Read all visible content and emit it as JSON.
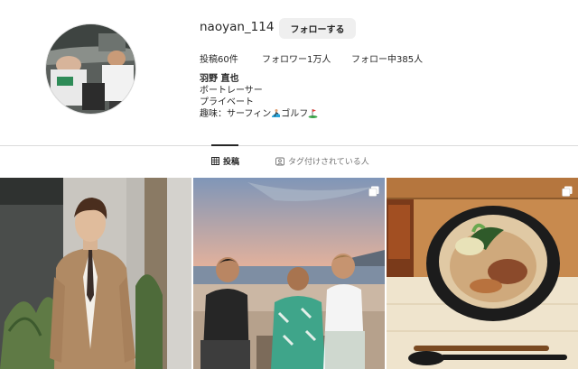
{
  "profile": {
    "username": "naoyan_114",
    "follow_label": "フォローする",
    "stats": {
      "posts": "投稿60件",
      "followers": "フォロワー1万人",
      "following": "フォロー中385人"
    },
    "bio": {
      "name": "羽野 直也",
      "line1": "ボートレーサー",
      "line2": "プライベート",
      "line3_prefix": "趣味：サーフィン",
      "line3_mid": "ゴルフ"
    }
  },
  "tabs": {
    "posts": "投稿",
    "tagged": "タグ付けされている人"
  },
  "icons": {
    "posts_tab": "grid-icon",
    "tagged_tab": "tag-person-icon",
    "multi": "multiple-photos-icon"
  }
}
